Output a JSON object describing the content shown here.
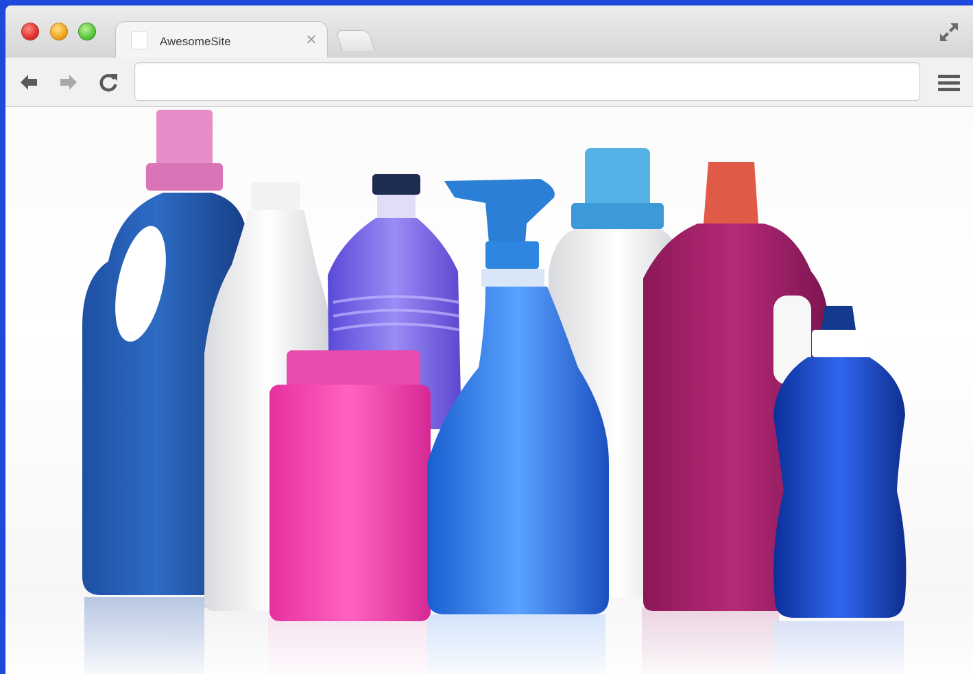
{
  "browser": {
    "tab": {
      "title": "AwesomeSite",
      "close_glyph": "×"
    },
    "address_bar": {
      "value": "",
      "placeholder": ""
    },
    "icons": [
      "back-arrow-icon",
      "forward-arrow-icon",
      "reload-icon",
      "hamburger-menu-icon",
      "fullscreen-icon"
    ]
  },
  "colors": {
    "desktop": "#1f48dc",
    "close": "#e0302a",
    "minimize": "#f2a21b",
    "maximize": "#5cc73a"
  }
}
